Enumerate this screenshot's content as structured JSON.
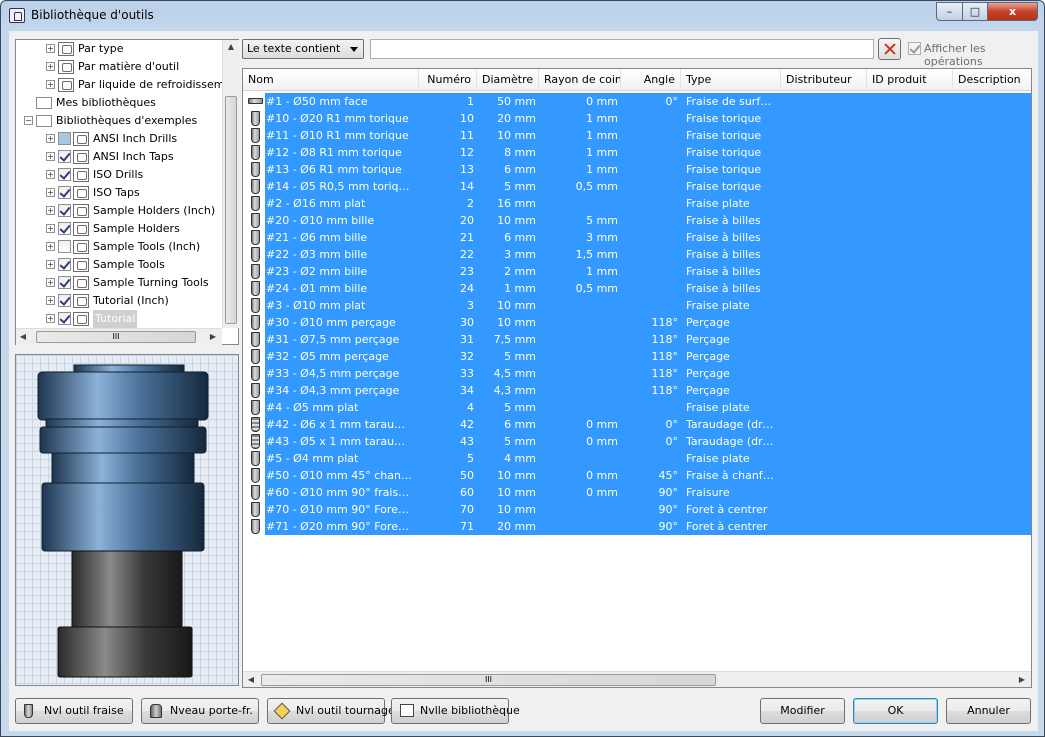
{
  "window": {
    "title": "Bibliothèque d'outils",
    "min": "–",
    "max": "□",
    "close": "x"
  },
  "tree": {
    "items": [
      {
        "label": "Par type",
        "indent": 2,
        "type": "filter"
      },
      {
        "label": "Par matière d'outil",
        "indent": 2,
        "type": "filter"
      },
      {
        "label": "Par liquide de refroidissemen",
        "indent": 2,
        "type": "filter"
      },
      {
        "label": "Mes bibliothèques",
        "indent": 1,
        "type": "folder"
      },
      {
        "label": "Bibliothèques d'exemples",
        "indent": 1,
        "type": "folder",
        "expand": "−"
      },
      {
        "label": "ANSI Inch Drills",
        "indent": 2,
        "type": "lib",
        "check": "part"
      },
      {
        "label": "ANSI Inch Taps",
        "indent": 2,
        "type": "lib",
        "check": "on"
      },
      {
        "label": "ISO Drills",
        "indent": 2,
        "type": "lib",
        "check": "on"
      },
      {
        "label": "ISO Taps",
        "indent": 2,
        "type": "lib",
        "check": "on"
      },
      {
        "label": "Sample Holders (Inch)",
        "indent": 2,
        "type": "lib",
        "check": "on"
      },
      {
        "label": "Sample Holders",
        "indent": 2,
        "type": "lib",
        "check": "on"
      },
      {
        "label": "Sample Tools (Inch)",
        "indent": 2,
        "type": "lib",
        "check": "off"
      },
      {
        "label": "Sample Tools",
        "indent": 2,
        "type": "lib",
        "check": "on"
      },
      {
        "label": "Sample Turning Tools",
        "indent": 2,
        "type": "lib",
        "check": "on"
      },
      {
        "label": "Tutorial (Inch)",
        "indent": 2,
        "type": "lib",
        "check": "on"
      },
      {
        "label": "Tutorial",
        "indent": 2,
        "type": "lib",
        "check": "on",
        "selected": true
      }
    ],
    "hscroll_thumb": "III"
  },
  "filter": {
    "mode": "Le texte contient",
    "value": "",
    "show_ops_label": "Afficher les opérations"
  },
  "grid": {
    "columns": [
      "Nom",
      "Numéro",
      "Diamètre",
      "Rayon de coin",
      "Angle",
      "Type",
      "Distributeur",
      "ID produit",
      "Description"
    ],
    "rows": [
      {
        "icon": "face",
        "name": "#1 - Ø50 mm face",
        "num": "1",
        "dia": "50 mm",
        "rad": "0 mm",
        "ang": "0°",
        "type": "Fraise de surfa…"
      },
      {
        "icon": "mill",
        "name": "#10 - Ø20 R1 mm torique",
        "num": "10",
        "dia": "20 mm",
        "rad": "1 mm",
        "ang": "",
        "type": "Fraise torique"
      },
      {
        "icon": "mill",
        "name": "#11 - Ø10 R1 mm torique",
        "num": "11",
        "dia": "10 mm",
        "rad": "1 mm",
        "ang": "",
        "type": "Fraise torique"
      },
      {
        "icon": "mill",
        "name": "#12 - Ø8 R1 mm torique",
        "num": "12",
        "dia": "8 mm",
        "rad": "1 mm",
        "ang": "",
        "type": "Fraise torique"
      },
      {
        "icon": "mill",
        "name": "#13 - Ø6 R1 mm torique",
        "num": "13",
        "dia": "6 mm",
        "rad": "1 mm",
        "ang": "",
        "type": "Fraise torique"
      },
      {
        "icon": "mill",
        "name": "#14 - Ø5 R0,5 mm torique",
        "num": "14",
        "dia": "5 mm",
        "rad": "0,5 mm",
        "ang": "",
        "type": "Fraise torique"
      },
      {
        "icon": "mill",
        "name": "#2 - Ø16 mm plat",
        "num": "2",
        "dia": "16 mm",
        "rad": "",
        "ang": "",
        "type": "Fraise plate"
      },
      {
        "icon": "mill",
        "name": "#20 - Ø10 mm bille",
        "num": "20",
        "dia": "10 mm",
        "rad": "5 mm",
        "ang": "",
        "type": "Fraise à billes"
      },
      {
        "icon": "mill",
        "name": "#21 - Ø6 mm bille",
        "num": "21",
        "dia": "6 mm",
        "rad": "3 mm",
        "ang": "",
        "type": "Fraise à billes"
      },
      {
        "icon": "mill",
        "name": "#22 - Ø3 mm bille",
        "num": "22",
        "dia": "3 mm",
        "rad": "1,5 mm",
        "ang": "",
        "type": "Fraise à billes"
      },
      {
        "icon": "mill",
        "name": "#23 - Ø2 mm bille",
        "num": "23",
        "dia": "2 mm",
        "rad": "1 mm",
        "ang": "",
        "type": "Fraise à billes"
      },
      {
        "icon": "mill",
        "name": "#24 - Ø1 mm bille",
        "num": "24",
        "dia": "1 mm",
        "rad": "0,5 mm",
        "ang": "",
        "type": "Fraise à billes"
      },
      {
        "icon": "mill",
        "name": "#3 - Ø10 mm plat",
        "num": "3",
        "dia": "10 mm",
        "rad": "",
        "ang": "",
        "type": "Fraise plate"
      },
      {
        "icon": "mill",
        "name": "#30 - Ø10 mm perçage",
        "num": "30",
        "dia": "10 mm",
        "rad": "",
        "ang": "118°",
        "type": "Perçage"
      },
      {
        "icon": "mill",
        "name": "#31 - Ø7,5 mm perçage",
        "num": "31",
        "dia": "7,5 mm",
        "rad": "",
        "ang": "118°",
        "type": "Perçage"
      },
      {
        "icon": "mill",
        "name": "#32 - Ø5 mm perçage",
        "num": "32",
        "dia": "5 mm",
        "rad": "",
        "ang": "118°",
        "type": "Perçage"
      },
      {
        "icon": "mill",
        "name": "#33 - Ø4,5 mm perçage",
        "num": "33",
        "dia": "4,5 mm",
        "rad": "",
        "ang": "118°",
        "type": "Perçage"
      },
      {
        "icon": "mill",
        "name": "#34 - Ø4,3 mm perçage",
        "num": "34",
        "dia": "4,3 mm",
        "rad": "",
        "ang": "118°",
        "type": "Perçage"
      },
      {
        "icon": "mill",
        "name": "#4 - Ø5 mm plat",
        "num": "4",
        "dia": "5 mm",
        "rad": "",
        "ang": "",
        "type": "Fraise plate"
      },
      {
        "icon": "tap",
        "name": "#42 - Ø6 x 1 mm taraudage …",
        "num": "42",
        "dia": "6 mm",
        "rad": "0 mm",
        "ang": "0°",
        "type": "Taraudage (dro…"
      },
      {
        "icon": "tap",
        "name": "#43 - Ø5 x 1 mm taraudage …",
        "num": "43",
        "dia": "5 mm",
        "rad": "0 mm",
        "ang": "0°",
        "type": "Taraudage (dro…"
      },
      {
        "icon": "mill",
        "name": "#5 - Ø4 mm plat",
        "num": "5",
        "dia": "4 mm",
        "rad": "",
        "ang": "",
        "type": "Fraise plate"
      },
      {
        "icon": "cham",
        "name": "#50 - Ø10 mm 45° chanfrein",
        "num": "50",
        "dia": "10 mm",
        "rad": "0 mm",
        "ang": "45°",
        "type": "Fraise à chanfr…"
      },
      {
        "icon": "cham",
        "name": "#60 - Ø10 mm 90° fraisure",
        "num": "60",
        "dia": "10 mm",
        "rad": "0 mm",
        "ang": "90°",
        "type": "Fraisure"
      },
      {
        "icon": "mill",
        "name": "#70 - Ø10 mm 90° Foret à c…",
        "num": "70",
        "dia": "10 mm",
        "rad": "",
        "ang": "90°",
        "type": "Foret à centrer"
      },
      {
        "icon": "mill",
        "name": "#71 - Ø20 mm 90° Foret à c…",
        "num": "71",
        "dia": "20 mm",
        "rad": "",
        "ang": "90°",
        "type": "Foret à centrer"
      }
    ],
    "hscroll_thumb": "III"
  },
  "buttons": {
    "new_mill": "Nvl outil fraise",
    "new_holder": "Nveau porte-fr.",
    "new_turning": "Nvl outil tournage",
    "new_library": "Nvlle bibliothèque",
    "modify": "Modifier",
    "ok": "OK",
    "cancel": "Annuler"
  },
  "colors": {
    "selection": "#3399ff",
    "window_frame": "#c3d6ec"
  }
}
